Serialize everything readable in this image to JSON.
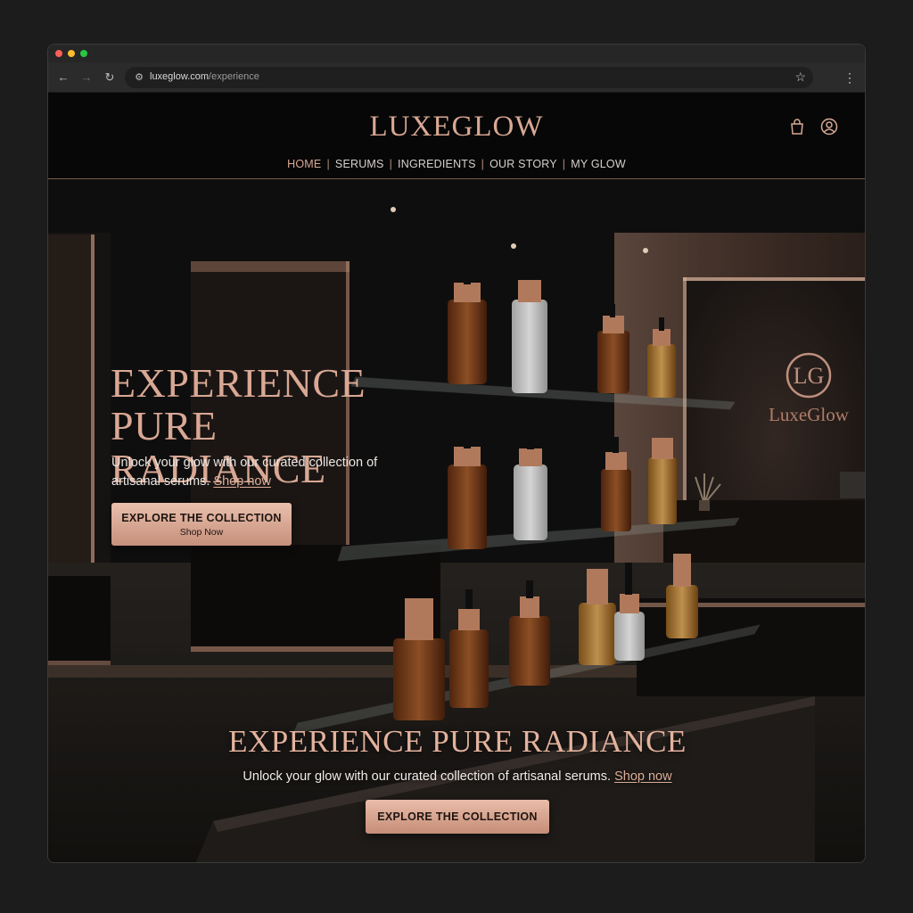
{
  "browser": {
    "url_domain": "luxeglow.com",
    "url_path": "/experience"
  },
  "site": {
    "logo": "LUXEGLOW",
    "nav": [
      "HOME",
      "SERUMS",
      "INGREDIENTS",
      "OUR STORY",
      "MY GLOW"
    ],
    "active_nav": "HOME",
    "icons": [
      "shopping-bag-icon",
      "account-icon"
    ],
    "accent_color": "#d9a894"
  },
  "hero": {
    "title_line1": "EXPERIENCE",
    "title_line2": "PURE RADIANCE",
    "subtitle": "Unlock your glow with our curated collection of artisanal serums.",
    "subtitle_link": "Shop now",
    "cta_label": "EXPLORE THE COLLECTION",
    "cta_sublabel": "Shop Now",
    "wall_sign_monogram": "LG",
    "wall_sign_text": "LuxeGlow"
  },
  "hero_bottom": {
    "title": "EXPERIENCE PURE RADIANCE",
    "subtitle": "Unlock your glow with our curated collection of artisanal serums.",
    "subtitle_link": "Shop now",
    "cta_label": "EXPLORE THE COLLECTION"
  }
}
